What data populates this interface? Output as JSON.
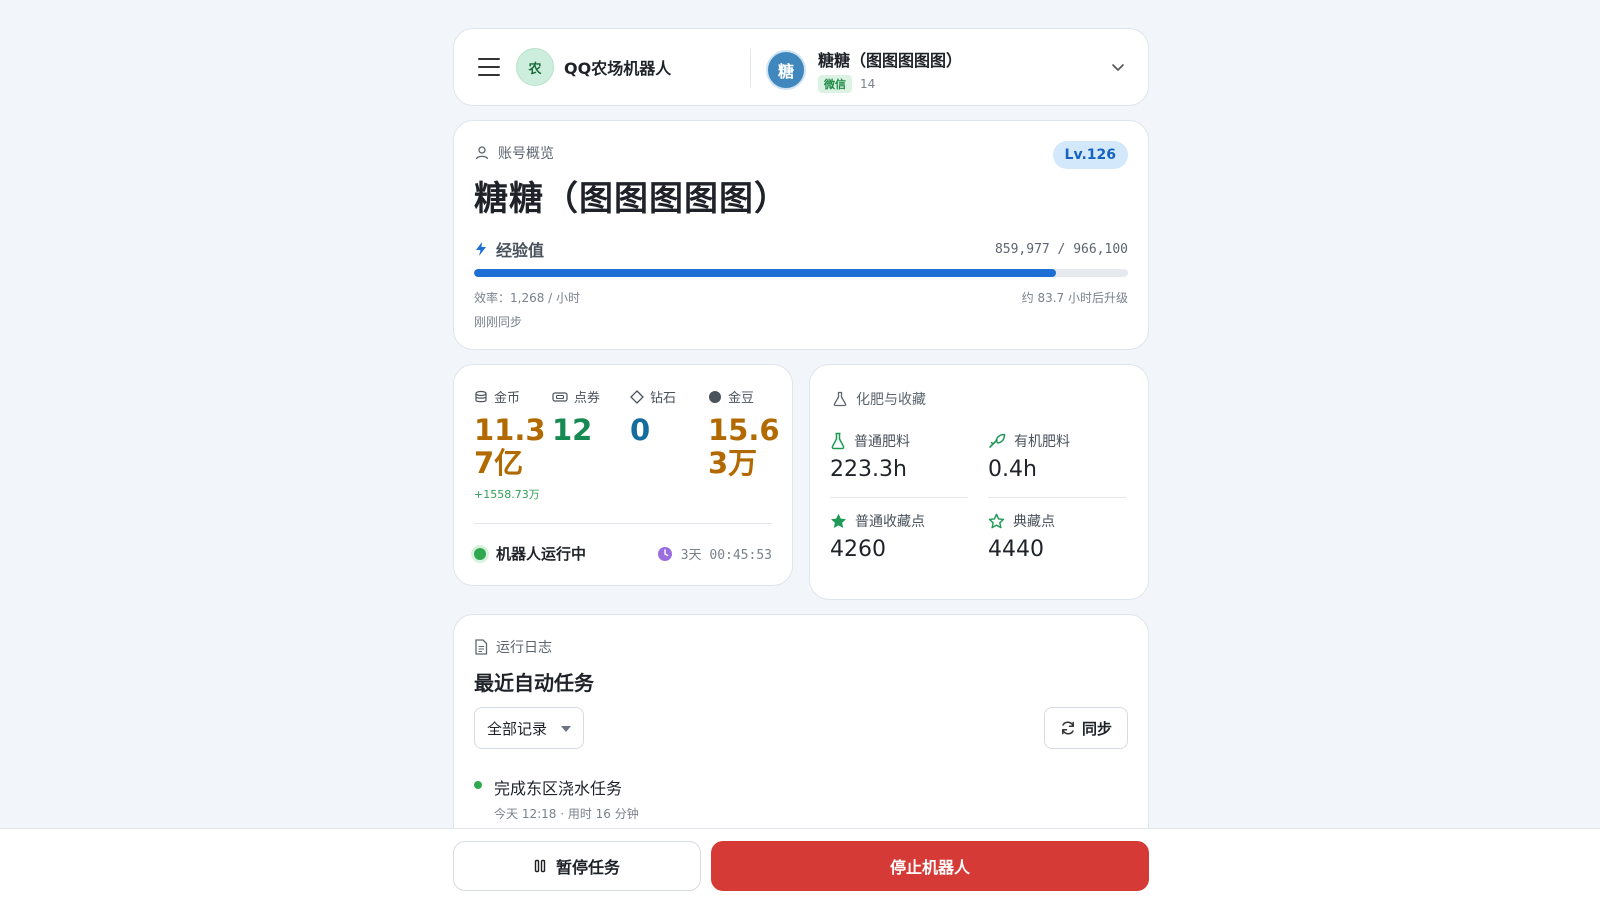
{
  "header": {
    "menu_icon": "menu-icon",
    "app_avatar_char": "农",
    "app_name": "QQ农场机器人",
    "account": {
      "avatar_char": "糖",
      "name": "糖糖（图图图图图）",
      "platform": "微信",
      "count": "14"
    },
    "dropdown_icon": "chevron-down-icon"
  },
  "overview": {
    "section_label": "账号概览",
    "level": "Lv.126",
    "title": "糖糖（图图图图图）",
    "exp_label": "经验值",
    "exp_value": "859,977 / 966,100",
    "exp_progress": 0.89,
    "efficiency": "效率：1,268 / 小时",
    "eta": "约 83.7 小时后升级",
    "sync_note": "刚刚同步",
    "colors": {
      "progress": "#1d6fd6",
      "badge_bg": "#d3e9fb",
      "badge_text": "#1565c0"
    }
  },
  "currencies": {
    "items": [
      {
        "icon": "coins-icon",
        "label": "金币",
        "value": "11.37亿",
        "delta": "+1558.73万",
        "color": "#b26a00"
      },
      {
        "icon": "ticket-icon",
        "label": "点券",
        "value": "12",
        "color": "#168a52"
      },
      {
        "icon": "diamond-icon",
        "label": "钻石",
        "value": "0",
        "color": "#156d9e"
      },
      {
        "icon": "bean-icon",
        "label": "金豆",
        "value": "15.63万",
        "color": "#b26a00"
      }
    ],
    "status": "机器人运行中",
    "uptime": "3天 00:45:53"
  },
  "fertilizer": {
    "section_label": "化肥与收藏",
    "cells": [
      {
        "icon": "flask-icon",
        "label": "普通肥料",
        "value": "223.3h"
      },
      {
        "icon": "sprout-icon",
        "label": "有机肥料",
        "value": "0.4h"
      },
      {
        "icon": "star-filled-icon",
        "label": "普通收藏点",
        "value": "4260"
      },
      {
        "icon": "star-outline-icon",
        "label": "典藏点",
        "value": "4440"
      }
    ]
  },
  "log": {
    "section_label": "运行日志",
    "title": "最近自动任务",
    "filter_value": "全部记录",
    "sync_label": "同步",
    "items": [
      {
        "text": "完成东区浇水任务",
        "meta": "今天 12:18 · 用时 16 分钟"
      }
    ]
  },
  "footer": {
    "pause_label": "暂停任务",
    "stop_label": "停止机器人",
    "stop_color": "#d63a36"
  }
}
